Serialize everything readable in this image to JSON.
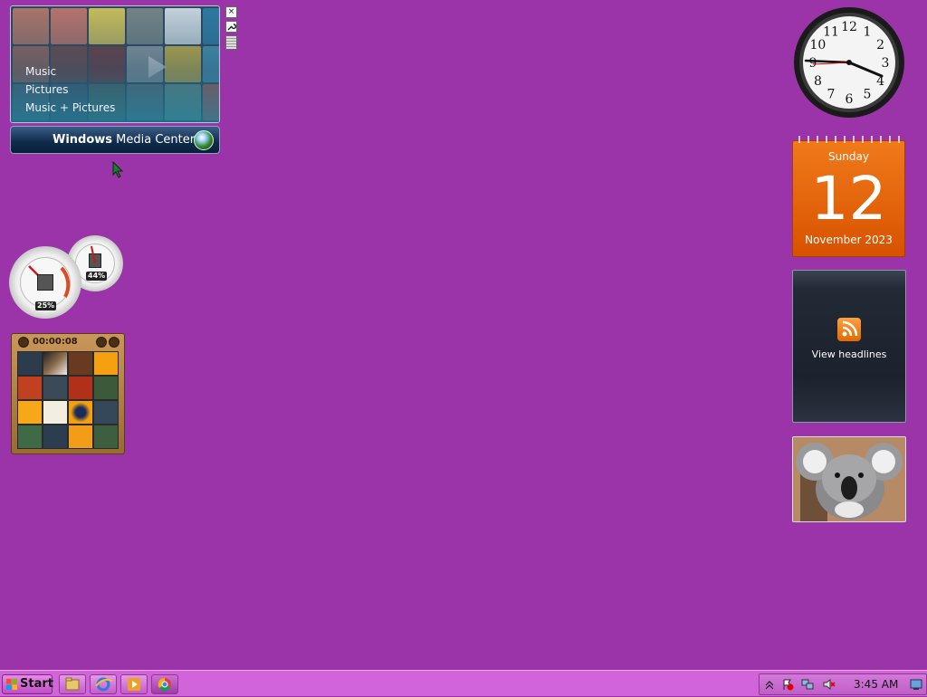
{
  "media_center": {
    "menu": [
      "Music",
      "Pictures",
      "Music + Pictures"
    ],
    "title_bold": "Windows",
    "title_rest": " Media Center",
    "tools": {
      "close": "×",
      "settings": "🔧"
    }
  },
  "cpu_meter": {
    "cpu_percent": "25%",
    "ram_percent": "44%"
  },
  "puzzle": {
    "timer": "00:00:08"
  },
  "clock": {
    "numbers": [
      "12",
      "1",
      "2",
      "3",
      "4",
      "5",
      "6",
      "7",
      "8",
      "9",
      "10",
      "11"
    ]
  },
  "calendar": {
    "day_of_week": "Sunday",
    "day": "12",
    "month_year": "November 2023"
  },
  "feed": {
    "label": "View headlines"
  },
  "taskbar": {
    "start_label": "Start",
    "clock": "3:45 AM"
  },
  "colors": {
    "desktop": "#9a34a8",
    "taskbar": "#d064d8",
    "calendar": "#e8650a"
  }
}
